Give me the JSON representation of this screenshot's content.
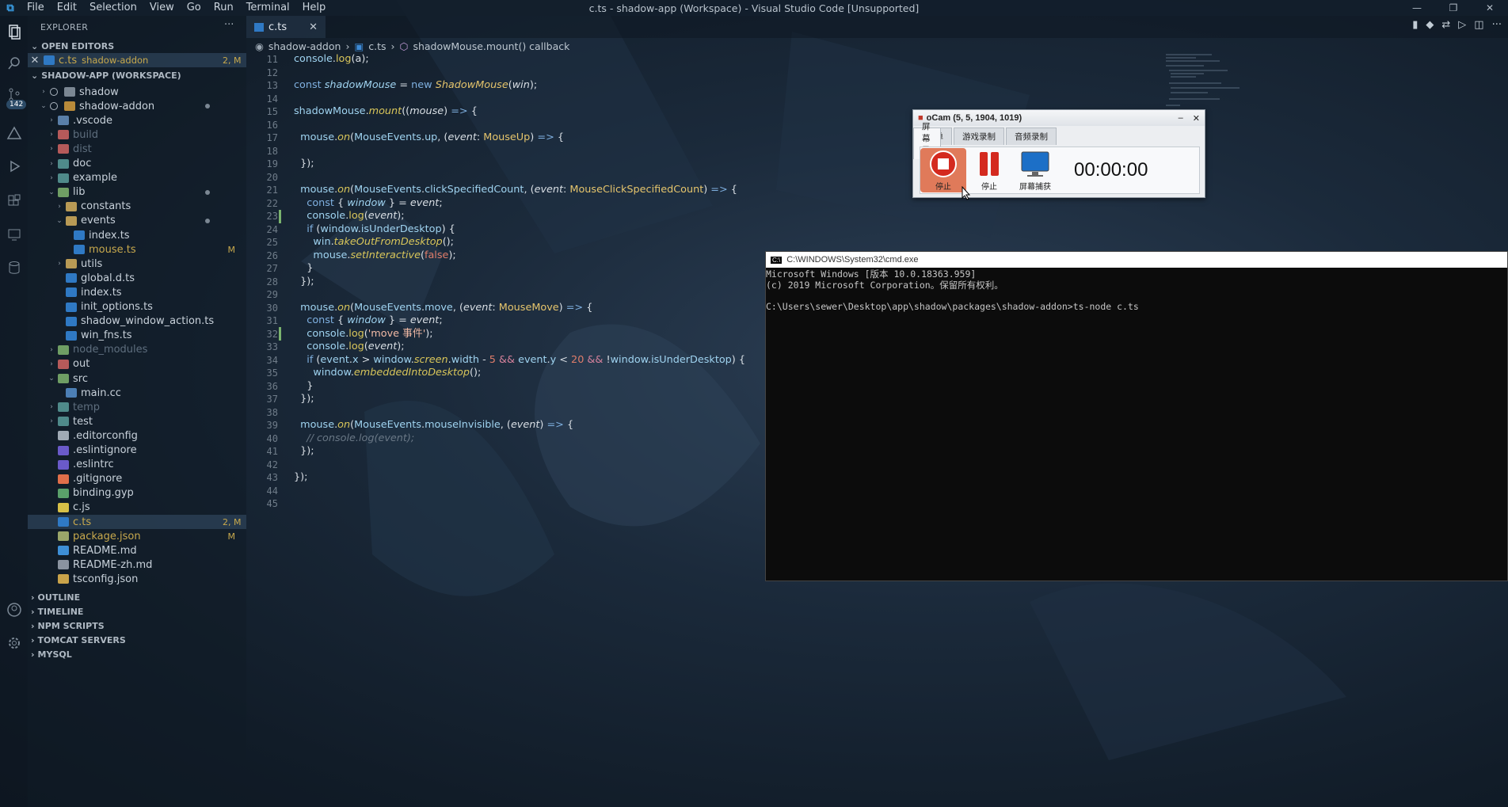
{
  "window": {
    "title": "c.ts - shadow-app (Workspace) - Visual Studio Code [Unsupported]",
    "menu": [
      "File",
      "Edit",
      "Selection",
      "View",
      "Go",
      "Run",
      "Terminal",
      "Help"
    ]
  },
  "activity": {
    "badge": "142"
  },
  "sidebar": {
    "header": "EXPLORER",
    "open_editors_label": "OPEN EDITORS",
    "open_editor": {
      "name": "c.ts",
      "folder": "shadow-addon",
      "status": "2, M"
    },
    "workspace_label": "SHADOW-APP (WORKSPACE)",
    "tree": [
      {
        "label": "shadow",
        "status": ""
      },
      {
        "label": "shadow-addon",
        "status": ""
      },
      {
        "label": ".vscode",
        "status": ""
      },
      {
        "label": "build",
        "status": ""
      },
      {
        "label": "dist",
        "status": ""
      },
      {
        "label": "doc",
        "status": ""
      },
      {
        "label": "example",
        "status": ""
      },
      {
        "label": "lib",
        "status": ""
      },
      {
        "label": "constants",
        "status": ""
      },
      {
        "label": "events",
        "status": ""
      },
      {
        "label": "index.ts",
        "status": ""
      },
      {
        "label": "mouse.ts",
        "status": "M"
      },
      {
        "label": "utils",
        "status": ""
      },
      {
        "label": "global.d.ts",
        "status": ""
      },
      {
        "label": "index.ts",
        "status": ""
      },
      {
        "label": "init_options.ts",
        "status": ""
      },
      {
        "label": "shadow_window_action.ts",
        "status": ""
      },
      {
        "label": "win_fns.ts",
        "status": ""
      },
      {
        "label": "node_modules",
        "status": ""
      },
      {
        "label": "out",
        "status": ""
      },
      {
        "label": "src",
        "status": ""
      },
      {
        "label": "main.cc",
        "status": ""
      },
      {
        "label": "temp",
        "status": ""
      },
      {
        "label": "test",
        "status": ""
      },
      {
        "label": ".editorconfig",
        "status": ""
      },
      {
        "label": ".eslintignore",
        "status": ""
      },
      {
        "label": ".eslintrc",
        "status": ""
      },
      {
        "label": ".gitignore",
        "status": ""
      },
      {
        "label": "binding.gyp",
        "status": ""
      },
      {
        "label": "c.js",
        "status": ""
      },
      {
        "label": "c.ts",
        "status": "2, M"
      },
      {
        "label": "package.json",
        "status": "M"
      },
      {
        "label": "README.md",
        "status": ""
      },
      {
        "label": "README-zh.md",
        "status": ""
      },
      {
        "label": "tsconfig.json",
        "status": ""
      }
    ],
    "sections": [
      "OUTLINE",
      "TIMELINE",
      "NPM SCRIPTS",
      "TOMCAT SERVERS",
      "MYSQL"
    ]
  },
  "editor": {
    "tab": "c.ts",
    "breadcrumb": [
      "shadow-addon",
      "c.ts",
      "shadowMouse.mount() callback"
    ],
    "line_numbers": [
      "11",
      "12",
      "13",
      "14",
      "15",
      "16",
      "17",
      "18",
      "19",
      "20",
      "21",
      "22",
      "23",
      "24",
      "25",
      "26",
      "27",
      "28",
      "29",
      "30",
      "31",
      "32",
      "33",
      "34",
      "35",
      "36",
      "37",
      "38",
      "39",
      "40",
      "41",
      "42",
      "43",
      "44",
      "45"
    ]
  },
  "ocam": {
    "title": "oCam (5, 5, 1904, 1019)",
    "tabs": [
      "菜单",
      "屏幕录制",
      "游戏录制",
      "音频录制"
    ],
    "stop_label": "停止",
    "pause_label": "停止",
    "capture_label": "屏幕捕获",
    "timer": "00:00:00"
  },
  "cmd": {
    "title": "C:\\WINDOWS\\System32\\cmd.exe",
    "lines": [
      "Microsoft Windows [版本 10.0.18363.959]",
      "(c) 2019 Microsoft Corporation。保留所有权利。",
      "",
      "C:\\Users\\sewer\\Desktop\\app\\shadow\\packages\\shadow-addon>ts-node c.ts"
    ]
  }
}
